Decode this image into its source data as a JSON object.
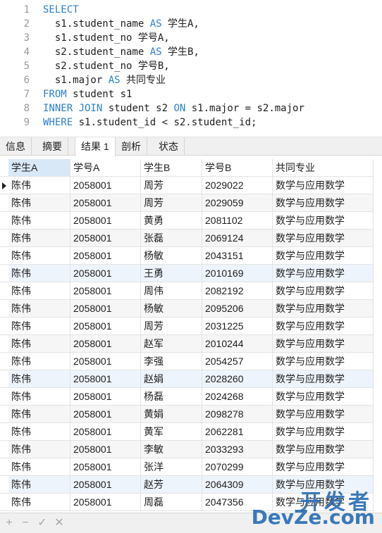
{
  "sql_lines": [
    {
      "no": "1",
      "segments": [
        {
          "t": "SELECT",
          "kw": true
        }
      ]
    },
    {
      "no": "2",
      "segments": [
        {
          "t": "  s1.student_name ",
          "kw": false
        },
        {
          "t": "AS",
          "kw": true
        },
        {
          "t": " 学生A,",
          "kw": false
        }
      ]
    },
    {
      "no": "3",
      "segments": [
        {
          "t": "  s1.student_no 学号A,",
          "kw": false
        }
      ]
    },
    {
      "no": "4",
      "segments": [
        {
          "t": "  s2.student_name ",
          "kw": false
        },
        {
          "t": "AS",
          "kw": true
        },
        {
          "t": " 学生B,",
          "kw": false
        }
      ]
    },
    {
      "no": "5",
      "segments": [
        {
          "t": "  s2.student_no 学号B,",
          "kw": false
        }
      ]
    },
    {
      "no": "6",
      "segments": [
        {
          "t": "  s1.major ",
          "kw": false
        },
        {
          "t": "AS",
          "kw": true
        },
        {
          "t": " 共同专业",
          "kw": false
        }
      ]
    },
    {
      "no": "7",
      "segments": [
        {
          "t": "FROM",
          "kw": true
        },
        {
          "t": " student s1",
          "kw": false
        }
      ]
    },
    {
      "no": "8",
      "segments": [
        {
          "t": "INNER JOIN",
          "kw": true
        },
        {
          "t": " student s2 ",
          "kw": false
        },
        {
          "t": "ON",
          "kw": true
        },
        {
          "t": " s1.major = s2.major",
          "kw": false
        }
      ]
    },
    {
      "no": "9",
      "segments": [
        {
          "t": "WHERE",
          "kw": true
        },
        {
          "t": " s1.student_id < s2.student_id;",
          "kw": false
        }
      ]
    }
  ],
  "tabs": [
    {
      "label": "信息",
      "active": false
    },
    {
      "label": "摘要",
      "active": false
    },
    {
      "label": "结果 1",
      "active": true
    },
    {
      "label": "剖析",
      "active": false
    },
    {
      "label": "状态",
      "active": false
    }
  ],
  "columns": [
    "学生A",
    "学号A",
    "学生B",
    "学号B",
    "共同专业"
  ],
  "rows": [
    [
      "陈伟",
      "2058001",
      "周芳",
      "2029022",
      "数学与应用数学"
    ],
    [
      "陈伟",
      "2058001",
      "周芳",
      "2029059",
      "数学与应用数学"
    ],
    [
      "陈伟",
      "2058001",
      "黄勇",
      "2081102",
      "数学与应用数学"
    ],
    [
      "陈伟",
      "2058001",
      "张磊",
      "2069124",
      "数学与应用数学"
    ],
    [
      "陈伟",
      "2058001",
      "杨敏",
      "2043151",
      "数学与应用数学"
    ],
    [
      "陈伟",
      "2058001",
      "王勇",
      "2010169",
      "数学与应用数学"
    ],
    [
      "陈伟",
      "2058001",
      "周伟",
      "2082192",
      "数学与应用数学"
    ],
    [
      "陈伟",
      "2058001",
      "杨敏",
      "2095206",
      "数学与应用数学"
    ],
    [
      "陈伟",
      "2058001",
      "周芳",
      "2031225",
      "数学与应用数学"
    ],
    [
      "陈伟",
      "2058001",
      "赵军",
      "2010244",
      "数学与应用数学"
    ],
    [
      "陈伟",
      "2058001",
      "李强",
      "2054257",
      "数学与应用数学"
    ],
    [
      "陈伟",
      "2058001",
      "赵娟",
      "2028260",
      "数学与应用数学"
    ],
    [
      "陈伟",
      "2058001",
      "杨磊",
      "2024268",
      "数学与应用数学"
    ],
    [
      "陈伟",
      "2058001",
      "黄娟",
      "2098278",
      "数学与应用数学"
    ],
    [
      "陈伟",
      "2058001",
      "黄军",
      "2062281",
      "数学与应用数学"
    ],
    [
      "陈伟",
      "2058001",
      "李敏",
      "2033293",
      "数学与应用数学"
    ],
    [
      "陈伟",
      "2058001",
      "张洋",
      "2070299",
      "数学与应用数学"
    ],
    [
      "陈伟",
      "2058001",
      "赵芳",
      "2064309",
      "数学与应用数学"
    ],
    [
      "陈伟",
      "2058001",
      "周磊",
      "2047356",
      "数学与应用数学"
    ]
  ],
  "highlight_rows": [
    5,
    11,
    17
  ],
  "toolbar": {
    "add_icon": "plus-icon",
    "remove_icon": "minus-icon",
    "confirm_icon": "check-icon",
    "cancel_icon": "x-icon"
  },
  "watermark": {
    "top": "开发者",
    "bottom": "DevZe.com"
  },
  "colors": {
    "keyword": "#2a7fc9",
    "watermark": "#2b6fb5",
    "sorted_header": "#d9e8f7"
  }
}
